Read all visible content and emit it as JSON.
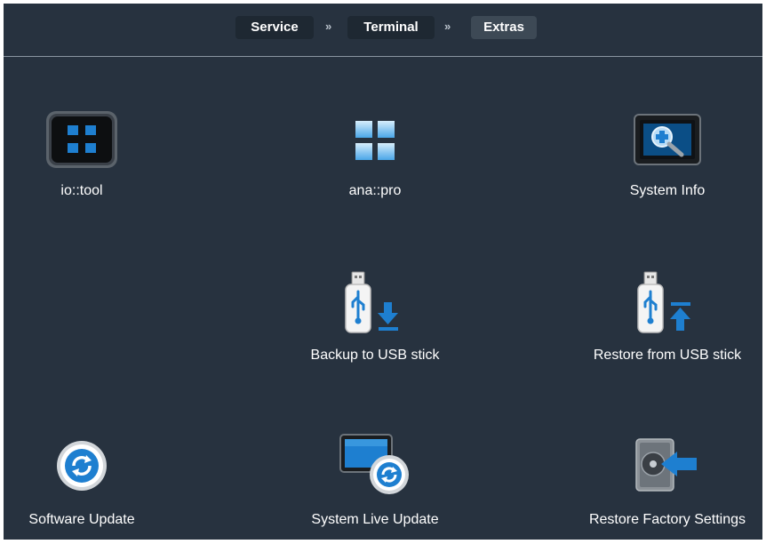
{
  "breadcrumb": [
    {
      "label": "Service"
    },
    {
      "label": "Terminal"
    },
    {
      "label": "Extras"
    }
  ],
  "separator": "»",
  "tiles": {
    "io_tool": {
      "label": "io::tool",
      "icon": "io-tool-icon"
    },
    "ana_pro": {
      "label": "ana::pro",
      "icon": "grid-icon"
    },
    "system_info": {
      "label": "System Info",
      "icon": "system-info-icon"
    },
    "backup_usb": {
      "label": "Backup to USB stick",
      "icon": "usb-download-icon"
    },
    "restore_usb": {
      "label": "Restore from USB stick",
      "icon": "usb-upload-icon"
    },
    "software_update": {
      "label": "Software Update",
      "icon": "refresh-icon"
    },
    "system_live_update": {
      "label": "System Live Update",
      "icon": "monitor-refresh-icon"
    },
    "restore_factory": {
      "label": "Restore Factory Settings",
      "icon": "hard-drive-restore-icon"
    }
  },
  "colors": {
    "background": "#27323f",
    "accent": "#1e7fd0",
    "crumb_bg": "#1e2832",
    "crumb_active_bg": "#3d4955"
  }
}
